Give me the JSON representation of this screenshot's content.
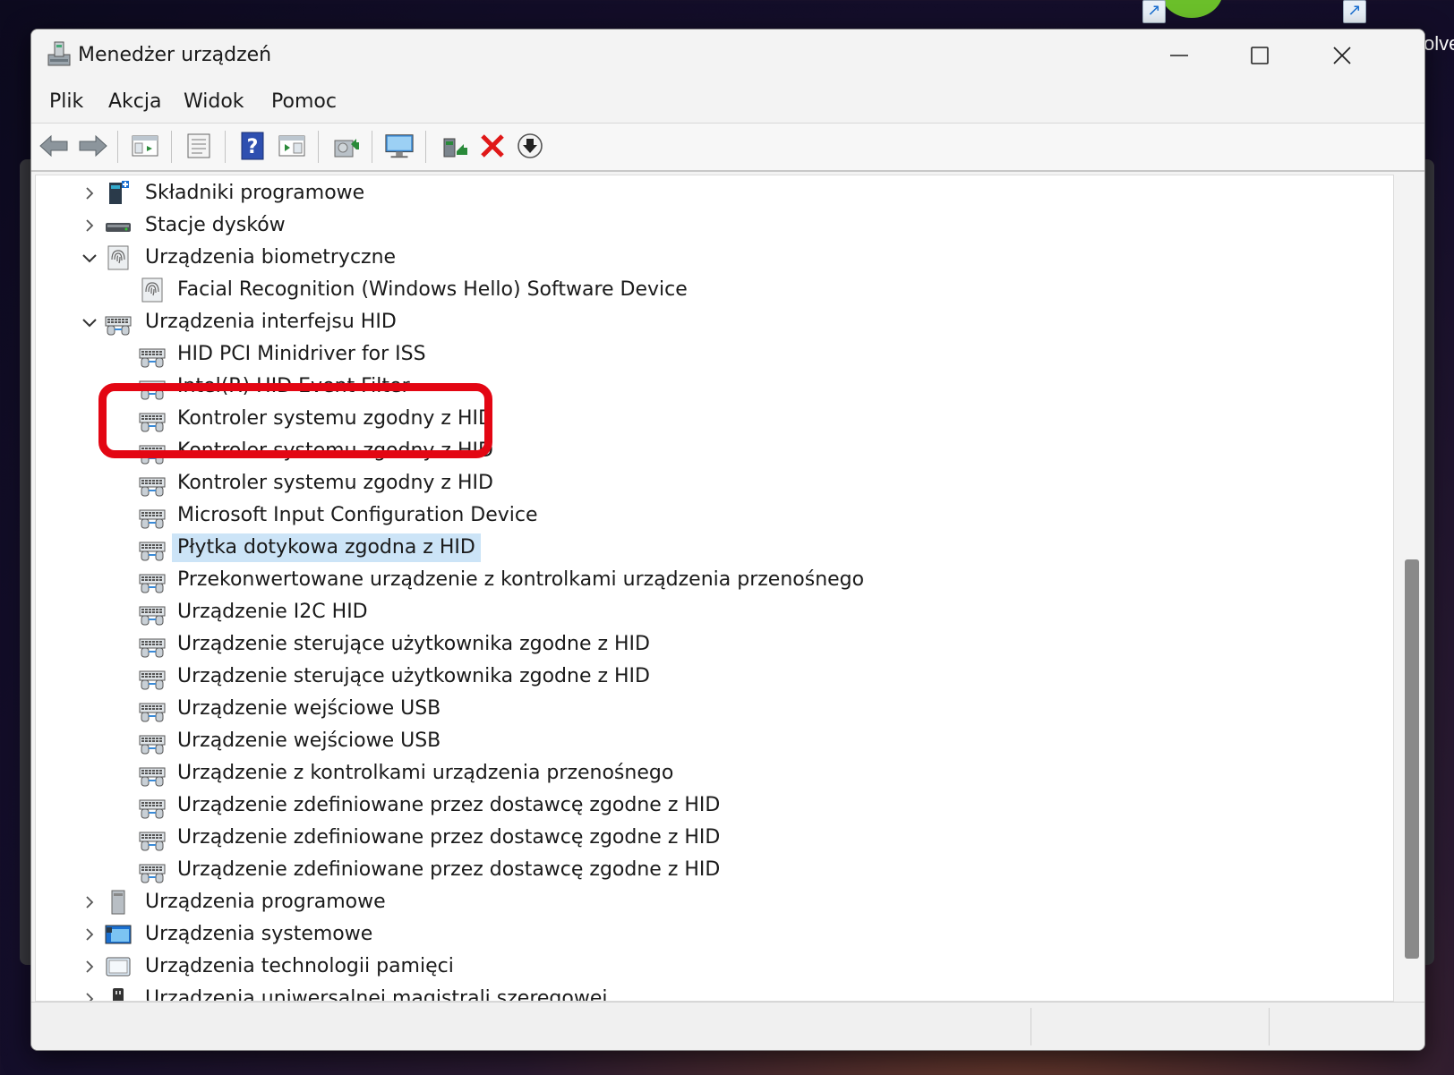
{
  "window": {
    "title": "Menedżer urządzeń",
    "minimize_icon": "minimize-icon",
    "maximize_icon": "maximize-icon",
    "close_icon": "close-icon"
  },
  "desktop": {
    "partial_text": "olve"
  },
  "menu": [
    "Plik",
    "Akcja",
    "Widok",
    "Pomoc"
  ],
  "toolbar": [
    {
      "name": "back-button",
      "icon": "arrow-left-icon"
    },
    {
      "name": "forward-button",
      "icon": "arrow-right-icon"
    },
    {
      "name": "show-hide-console-tree-button",
      "icon": "console-tree-icon"
    },
    {
      "name": "properties-button",
      "icon": "properties-icon"
    },
    {
      "name": "help-button",
      "icon": "help-icon"
    },
    {
      "name": "show-action-pane-button",
      "icon": "action-pane-icon"
    },
    {
      "name": "update-driver-button",
      "icon": "update-driver-icon"
    },
    {
      "name": "scan-hardware-button",
      "icon": "scan-hardware-icon"
    },
    {
      "name": "enable-device-button",
      "icon": "enable-device-icon"
    },
    {
      "name": "uninstall-device-button",
      "icon": "uninstall-device-icon"
    },
    {
      "name": "disable-device-button",
      "icon": "disable-device-icon"
    }
  ],
  "tree": [
    {
      "label": "Składniki programowe",
      "level": 0,
      "state": "collapsed",
      "icon": "software-components-icon"
    },
    {
      "label": "Stacje dysków",
      "level": 0,
      "state": "collapsed",
      "icon": "disk-drive-icon"
    },
    {
      "label": "Urządzenia biometryczne",
      "level": 0,
      "state": "expanded",
      "icon": "fingerprint-icon"
    },
    {
      "label": "Facial Recognition (Windows Hello) Software Device",
      "level": 1,
      "icon": "fingerprint-icon"
    },
    {
      "label": "Urządzenia interfejsu HID",
      "level": 0,
      "state": "expanded",
      "icon": "hid-icon"
    },
    {
      "label": "HID PCI Minidriver for ISS",
      "level": 1,
      "icon": "hid-icon"
    },
    {
      "label": "Intel(R) HID Event Filter",
      "level": 1,
      "icon": "hid-icon"
    },
    {
      "label": "Kontroler systemu zgodny z HID",
      "level": 1,
      "icon": "hid-icon"
    },
    {
      "label": "Kontroler systemu zgodny z HID",
      "level": 1,
      "icon": "hid-icon"
    },
    {
      "label": "Kontroler systemu zgodny z HID",
      "level": 1,
      "icon": "hid-icon"
    },
    {
      "label": "Microsoft Input Configuration Device",
      "level": 1,
      "icon": "hid-icon"
    },
    {
      "label": "Płytka dotykowa zgodna z HID",
      "level": 1,
      "icon": "hid-icon",
      "selected": true
    },
    {
      "label": "Przekonwertowane urządzenie z kontrolkami urządzenia przenośnego",
      "level": 1,
      "icon": "hid-icon"
    },
    {
      "label": "Urządzenie I2C HID",
      "level": 1,
      "icon": "hid-icon"
    },
    {
      "label": "Urządzenie sterujące użytkownika zgodne z HID",
      "level": 1,
      "icon": "hid-icon"
    },
    {
      "label": "Urządzenie sterujące użytkownika zgodne z HID",
      "level": 1,
      "icon": "hid-icon"
    },
    {
      "label": "Urządzenie wejściowe USB",
      "level": 1,
      "icon": "hid-icon"
    },
    {
      "label": "Urządzenie wejściowe USB",
      "level": 1,
      "icon": "hid-icon"
    },
    {
      "label": "Urządzenie z kontrolkami urządzenia przenośnego",
      "level": 1,
      "icon": "hid-icon"
    },
    {
      "label": "Urządzenie zdefiniowane przez dostawcę zgodne z HID",
      "level": 1,
      "icon": "hid-icon"
    },
    {
      "label": "Urządzenie zdefiniowane przez dostawcę zgodne z HID",
      "level": 1,
      "icon": "hid-icon"
    },
    {
      "label": "Urządzenie zdefiniowane przez dostawcę zgodne z HID",
      "level": 1,
      "icon": "hid-icon"
    },
    {
      "label": "Urządzenia programowe",
      "level": 0,
      "state": "collapsed",
      "icon": "software-device-icon"
    },
    {
      "label": "Urządzenia systemowe",
      "level": 0,
      "state": "collapsed",
      "icon": "system-device-icon"
    },
    {
      "label": "Urządzenia technologii pamięci",
      "level": 0,
      "state": "collapsed",
      "icon": "memory-tech-icon"
    },
    {
      "label": "Urządzenia uniwersalnej magistrali szeregowej",
      "level": 0,
      "state": "collapsed",
      "icon": "usb-icon"
    }
  ],
  "colors": {
    "selection": "#cce4f7",
    "highlight_box": "#e30613",
    "window_bg": "#f3f3f3"
  }
}
